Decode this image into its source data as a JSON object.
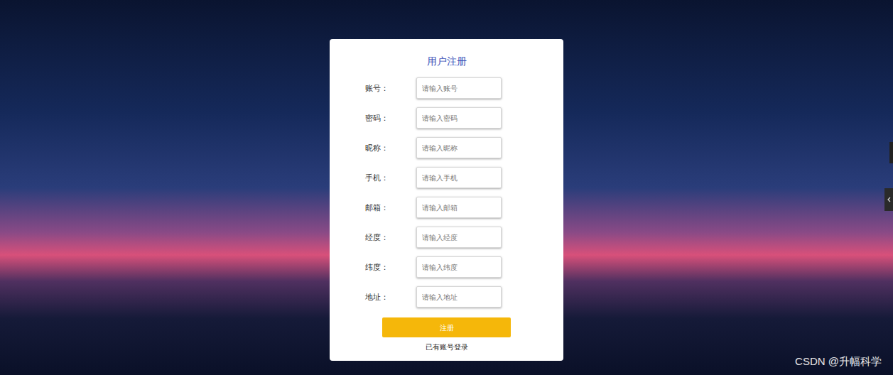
{
  "title": "用户注册",
  "fields": [
    {
      "label": "账号：",
      "placeholder": "请输入账号"
    },
    {
      "label": "密码：",
      "placeholder": "请输入密码"
    },
    {
      "label": "昵称：",
      "placeholder": "请输入昵称"
    },
    {
      "label": "手机：",
      "placeholder": "请输入手机"
    },
    {
      "label": "邮箱：",
      "placeholder": "请输入邮箱"
    },
    {
      "label": "经度：",
      "placeholder": "请输入经度"
    },
    {
      "label": "纬度：",
      "placeholder": "请输入纬度"
    },
    {
      "label": "地址：",
      "placeholder": "请输入地址"
    }
  ],
  "submit": "注册",
  "login_link": "已有账号登录",
  "watermark": "CSDN @升幅科学"
}
